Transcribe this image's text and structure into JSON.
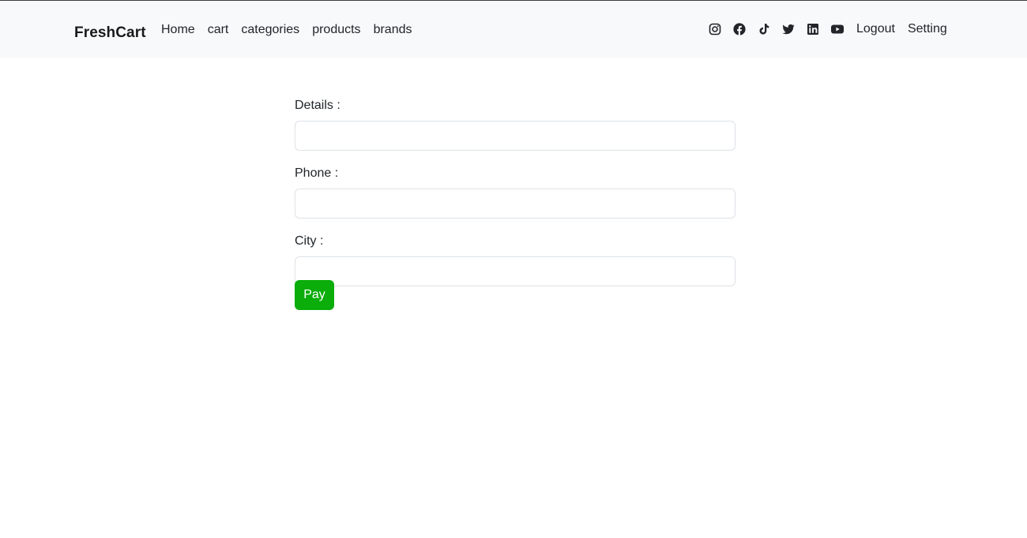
{
  "navbar": {
    "brand": "FreshCart",
    "links": [
      "Home",
      "cart",
      "categories",
      "products",
      "brands"
    ],
    "social_icons": [
      "instagram-icon",
      "facebook-icon",
      "tiktok-icon",
      "twitter-icon",
      "linkedin-icon",
      "youtube-icon"
    ],
    "logout": "Logout",
    "setting": "Setting",
    "background": "#f8f9fa"
  },
  "form": {
    "details_label": "Details :",
    "details_value": "",
    "phone_label": "Phone :",
    "phone_value": "",
    "city_label": "City :",
    "city_value": "",
    "pay_label": "Pay",
    "pay_color": "#0aad0a"
  }
}
